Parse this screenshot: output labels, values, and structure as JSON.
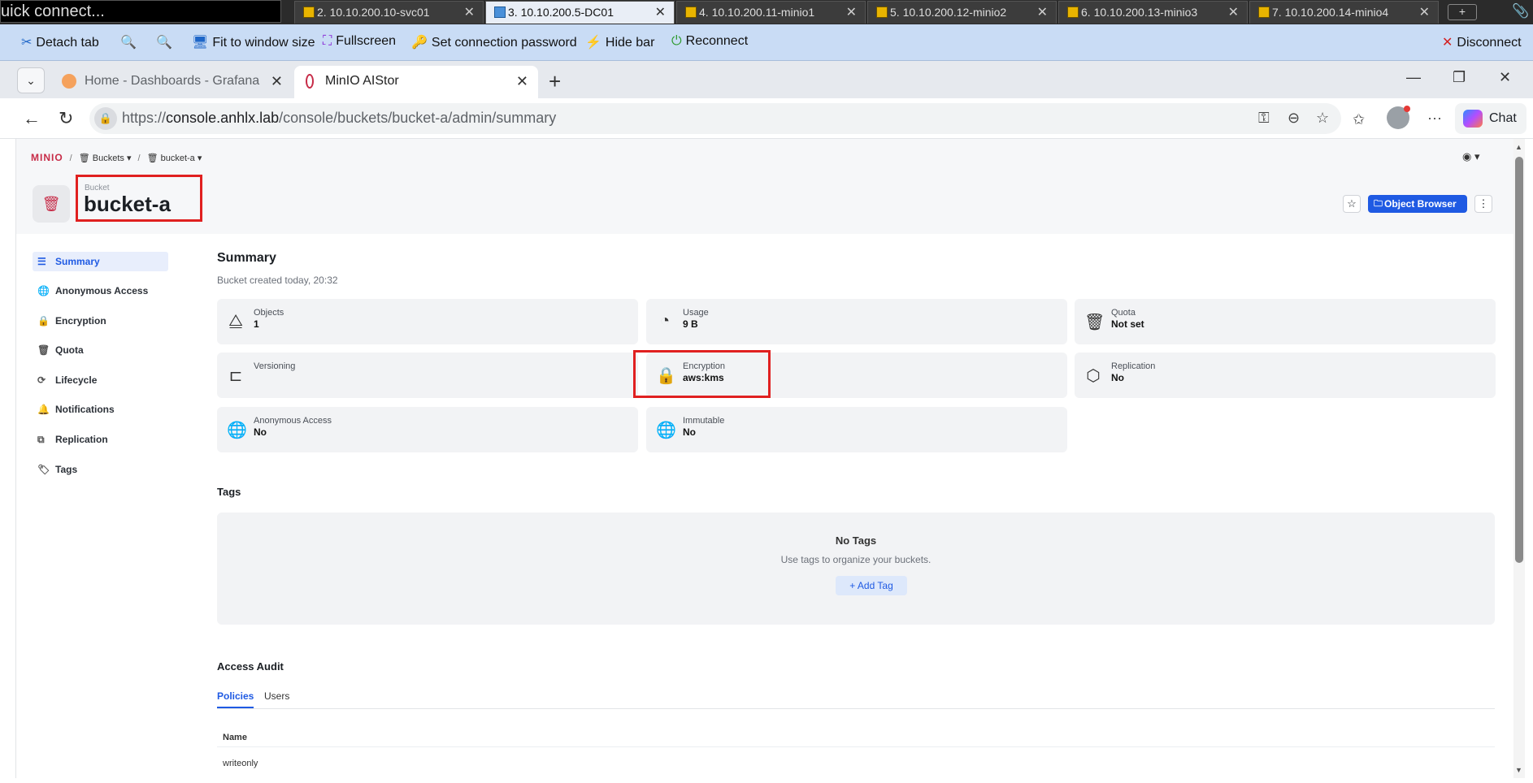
{
  "remote_tabs": {
    "quick_connect": "uick connect...",
    "tabs": [
      {
        "label": "2. 10.10.200.10-svc01",
        "active": false
      },
      {
        "label": "3. 10.10.200.5-DC01",
        "active": true
      },
      {
        "label": "4. 10.10.200.11-minio1",
        "active": false
      },
      {
        "label": "5. 10.10.200.12-minio2",
        "active": false
      },
      {
        "label": "6. 10.10.200.13-minio3",
        "active": false
      },
      {
        "label": "7. 10.10.200.14-minio4",
        "active": false
      }
    ],
    "new_tab": "+"
  },
  "remote_toolbar": {
    "detach": "Detach tab",
    "fit": "Fit to window size",
    "fullscreen": "Fullscreen",
    "set_password": "Set connection password",
    "hide_bar": "Hide bar",
    "reconnect": "Reconnect",
    "disconnect": "Disconnect"
  },
  "browser": {
    "tabs": [
      {
        "label": "Home - Dashboards - Grafana"
      },
      {
        "label": "MinIO AIStor"
      }
    ],
    "url_prefix": "https://",
    "url_host": "console.anhlx.lab",
    "url_path": "/console/buckets/bucket-a/admin/summary",
    "chat_label": "Chat"
  },
  "header": {
    "logo": "MINIO",
    "crumb_buckets": "Buckets",
    "crumb_bucket": "bucket-a",
    "bucket_label": "Bucket",
    "bucket_name": "bucket-a",
    "object_browser": "Object Browser"
  },
  "sidebar": {
    "items": [
      {
        "label": "Summary",
        "icon": "list-icon"
      },
      {
        "label": "Anonymous Access",
        "icon": "globe-icon"
      },
      {
        "label": "Encryption",
        "icon": "lock-icon"
      },
      {
        "label": "Quota",
        "icon": "quota-icon"
      },
      {
        "label": "Lifecycle",
        "icon": "lifecycle-icon"
      },
      {
        "label": "Notifications",
        "icon": "bell-icon"
      },
      {
        "label": "Replication",
        "icon": "replication-icon"
      },
      {
        "label": "Tags",
        "icon": "tags-icon"
      }
    ]
  },
  "summary": {
    "title": "Summary",
    "subtitle": "Bucket created today, 20:32",
    "cards": [
      {
        "label": "Objects",
        "value": "1",
        "icon": "shapes-icon"
      },
      {
        "label": "Usage",
        "value": "9 B",
        "icon": "pie-icon"
      },
      {
        "label": "Quota",
        "value": "Not set",
        "icon": "quota-icon"
      },
      {
        "label": "Versioning",
        "value": "",
        "icon": "versioning-icon"
      },
      {
        "label": "Encryption",
        "value": "aws:kms",
        "icon": "lock-icon"
      },
      {
        "label": "Replication",
        "value": "No",
        "icon": "replication-icon"
      },
      {
        "label": "Anonymous Access",
        "value": "No",
        "icon": "globe-icon"
      },
      {
        "label": "Immutable",
        "value": "No",
        "icon": "globe-icon"
      }
    ]
  },
  "tags": {
    "title": "Tags",
    "empty_title": "No Tags",
    "empty_sub": "Use tags to organize your buckets.",
    "add_label": "+ Add Tag"
  },
  "audit": {
    "title": "Access Audit",
    "tabs": [
      "Policies",
      "Users"
    ],
    "column": "Name",
    "rows": [
      "writeonly"
    ]
  },
  "colors": {
    "accent": "#1f5ae3",
    "brand": "#c72c48",
    "highlight": "#e02020"
  }
}
